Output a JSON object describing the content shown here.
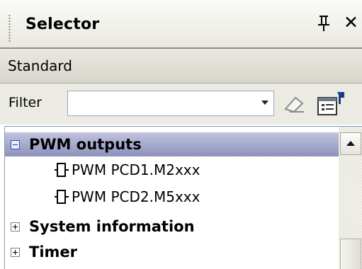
{
  "panel": {
    "title": "Selector"
  },
  "category": {
    "label": "Standard"
  },
  "filter": {
    "label": "Filter",
    "value": ""
  },
  "tree": {
    "groups": [
      {
        "label": "PWM outputs",
        "expanded": true,
        "items": [
          {
            "label": "PWM PCD1.M2xxx"
          },
          {
            "label": "PWM PCD2.M5xxx"
          }
        ]
      },
      {
        "label": "System information",
        "expanded": false,
        "items": []
      },
      {
        "label": "Timer",
        "expanded": false,
        "items": []
      }
    ]
  },
  "colors": {
    "selected_group_bg": "#9fa3c8",
    "panel_bg": "#ebeae3",
    "tree_border": "#7f9db9"
  }
}
